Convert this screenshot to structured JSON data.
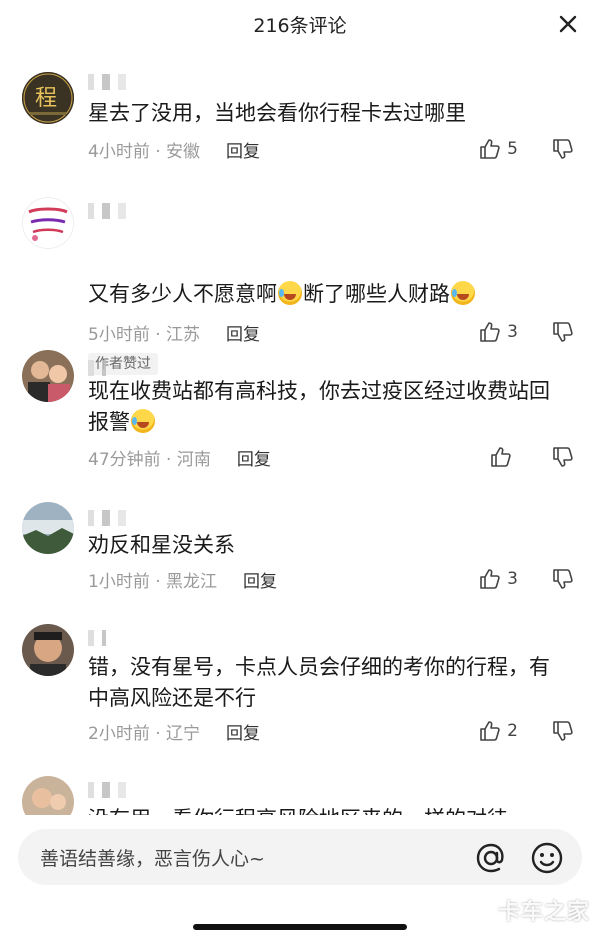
{
  "header": {
    "title": "216条评论"
  },
  "comments": [
    {
      "text": "星去了没用，当地会看你行程卡去过哪里",
      "meta": "4小时前 · 安徽",
      "reply": "回复",
      "likes": "5",
      "avatar_char": "程"
    },
    {
      "text_a": "又有多少人不愿意啊",
      "text_b": "断了哪些人财路",
      "meta": "5小时前 · 江苏",
      "reply": "回复",
      "likes": "3",
      "badge": "作者赞过"
    },
    {
      "text_a": "现在收费站都有高科技，你去过疫区经过收费站回",
      "text_b": "报警",
      "meta": "47分钟前 · 河南",
      "reply": "回复",
      "likes": ""
    },
    {
      "text": "劝反和星没关系",
      "meta": "1小时前 · 黑龙江",
      "reply": "回复",
      "likes": "3"
    },
    {
      "text_a": "错，没有星号，卡点人员会仔细的考你的行程，有",
      "text_b": "中高风险还是不行",
      "meta": "2小时前 · 辽宁",
      "reply": "回复",
      "likes": "2"
    },
    {
      "text": "没有用，看你行程高风险地区来的一样的对待"
    }
  ],
  "input": {
    "placeholder": "善语结善缘，恶言伤人心~"
  },
  "watermark": "卡车之家",
  "icons": {
    "close": "close-icon",
    "like": "thumbs-up-icon",
    "dislike": "thumbs-down-icon",
    "at": "at-icon",
    "emoji": "emoji-face-icon"
  }
}
